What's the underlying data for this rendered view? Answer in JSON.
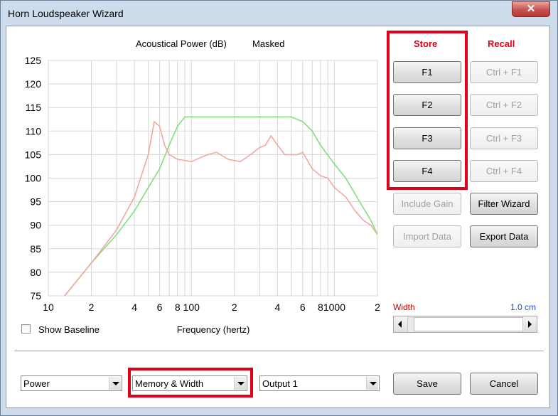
{
  "window": {
    "title": "Horn Loudspeaker Wizard",
    "close_glyph": "✕"
  },
  "chart_data": {
    "type": "line",
    "title": "Acoustical Power (dB)",
    "subtitle": "Masked",
    "xlabel": "Frequency (hertz)",
    "ylabel": "",
    "x_scale": "log",
    "xlim": [
      10,
      2000
    ],
    "ylim": [
      75,
      125
    ],
    "grid": true,
    "y_ticks": [
      "125",
      "120",
      "115",
      "110",
      "105",
      "100",
      "95",
      "90",
      "85",
      "80",
      "75"
    ],
    "x_ticks": [
      "10",
      "2",
      "4",
      "6",
      "8",
      "100",
      "2",
      "4",
      "6",
      "8",
      "1000",
      "2"
    ],
    "series": [
      {
        "color": "#7fe07f",
        "points": [
          [
            13,
            75
          ],
          [
            20,
            82
          ],
          [
            30,
            88
          ],
          [
            40,
            93
          ],
          [
            50,
            98
          ],
          [
            60,
            102
          ],
          [
            70,
            107
          ],
          [
            80,
            111
          ],
          [
            90,
            113
          ],
          [
            100,
            113
          ],
          [
            150,
            113
          ],
          [
            200,
            113
          ],
          [
            300,
            113
          ],
          [
            400,
            113
          ],
          [
            500,
            113
          ],
          [
            600,
            112
          ],
          [
            700,
            110
          ],
          [
            800,
            107
          ],
          [
            1000,
            103
          ],
          [
            1200,
            100
          ],
          [
            1500,
            95
          ],
          [
            1800,
            91
          ],
          [
            2000,
            88
          ]
        ]
      },
      {
        "color": "#f2a8a0",
        "points": [
          [
            13,
            75
          ],
          [
            20,
            82
          ],
          [
            30,
            89
          ],
          [
            40,
            96
          ],
          [
            50,
            105
          ],
          [
            55,
            112
          ],
          [
            60,
            111
          ],
          [
            65,
            107
          ],
          [
            70,
            105
          ],
          [
            80,
            104
          ],
          [
            100,
            103.5
          ],
          [
            130,
            105
          ],
          [
            150,
            105.5
          ],
          [
            180,
            104
          ],
          [
            220,
            103.5
          ],
          [
            260,
            105
          ],
          [
            300,
            106.5
          ],
          [
            330,
            107
          ],
          [
            360,
            109
          ],
          [
            400,
            107
          ],
          [
            450,
            105
          ],
          [
            550,
            105
          ],
          [
            600,
            105.5
          ],
          [
            700,
            102
          ],
          [
            800,
            100.5
          ],
          [
            900,
            100
          ],
          [
            1000,
            98
          ],
          [
            1200,
            96
          ],
          [
            1400,
            93
          ],
          [
            1600,
            91
          ],
          [
            1800,
            90
          ],
          [
            2000,
            88
          ]
        ]
      }
    ]
  },
  "options": {
    "show_baseline_label": "Show Baseline",
    "show_baseline_checked": false
  },
  "store": {
    "header": "Store",
    "buttons": [
      "F1",
      "F2",
      "F3",
      "F4"
    ]
  },
  "recall": {
    "header": "Recall",
    "buttons": [
      "Ctrl + F1",
      "Ctrl + F2",
      "Ctrl + F3",
      "Ctrl + F4"
    ]
  },
  "actions": {
    "include_gain": "Include Gain",
    "filter_wizard": "Filter Wizard",
    "import_data": "Import Data",
    "export_data": "Export Data"
  },
  "width_control": {
    "label": "Width",
    "value": "1.0 cm",
    "label_color": "#c00000",
    "value_color": "#1a4fc6",
    "slider_fraction": 0.0
  },
  "bottom": {
    "display_select": "Power",
    "mode_select": "Memory & Width",
    "output_select": "Output 1",
    "save": "Save",
    "cancel": "Cancel"
  }
}
